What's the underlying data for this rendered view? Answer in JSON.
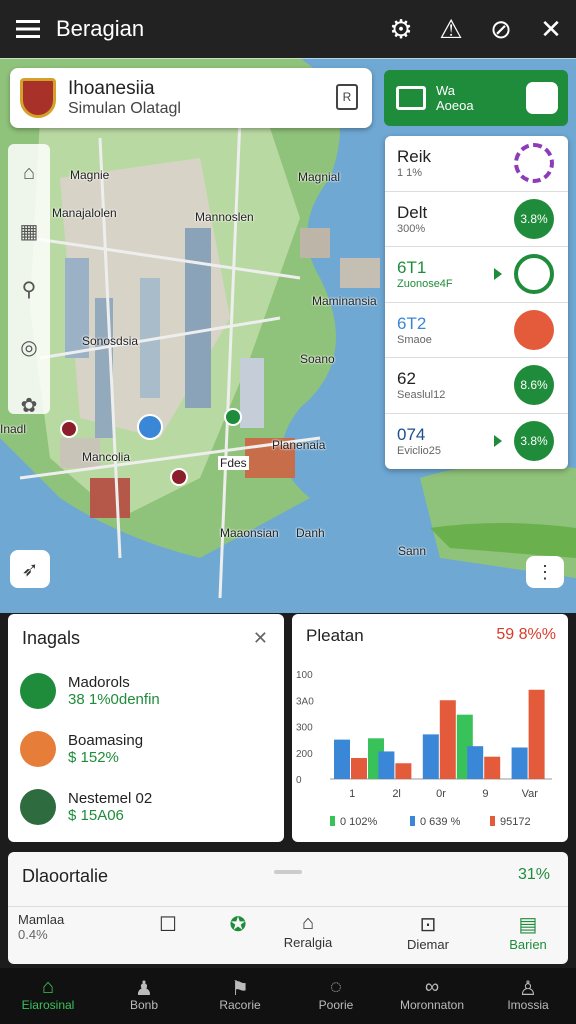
{
  "topbar": {
    "title": "Beragian"
  },
  "city_card": {
    "name": "Ihoanesiia",
    "subtitle": "Simulan Olatagl"
  },
  "action_button": {
    "line1": "Wa",
    "line2": "Aoeoa"
  },
  "right_panel": {
    "rows": [
      {
        "title": "Reik",
        "sub": "1 1%",
        "circle": ""
      },
      {
        "title": "Delt",
        "sub": "300%",
        "circle": "3.8%"
      },
      {
        "title": "6T1",
        "sub": "Zuonose4F",
        "circle": ""
      },
      {
        "title": "6T2",
        "sub": "Smaoe",
        "circle": ""
      },
      {
        "title": "62",
        "sub": "Seaslul12",
        "circle": "8.6%"
      },
      {
        "title": "074",
        "sub": "Eviclio25",
        "circle": "3.8%"
      }
    ]
  },
  "map_labels": {
    "l1": "Magnie",
    "l2": "Manajalolen",
    "l3": "Mannoslen",
    "l4": "Magnial",
    "l5": "Maminansia",
    "l6": "Sonosdsia",
    "l7": "Soano",
    "l8": "Inadl",
    "l9": "Mancolia",
    "l10": "Planenaia",
    "l11": "Maaonsian",
    "l12": "Danh",
    "l13": "Sann",
    "l14": "Fdes"
  },
  "insights": {
    "title": "Inagals",
    "items": [
      {
        "name": "Madorols",
        "value": "38 1%0denfin"
      },
      {
        "name": "Boamasing",
        "value": "$ 152%"
      },
      {
        "name": "Nestemel 02",
        "value": "$ 15A06"
      }
    ]
  },
  "chart_panel": {
    "title": "Pleatan",
    "pct": "59 8%%"
  },
  "chart_data": {
    "type": "bar",
    "categories": [
      "1",
      "2l",
      "0r",
      "9",
      "Var"
    ],
    "ylim": [
      0,
      400
    ],
    "ytick_labels": [
      "100",
      "3A0",
      "300",
      "200",
      "0"
    ],
    "legend_labels": [
      "0 102%",
      "0 639 %",
      "95172"
    ],
    "series": [
      {
        "color": "#3a87d8",
        "values": [
          150,
          105,
          170,
          125,
          120
        ]
      },
      {
        "color": "#e35b3a",
        "values": [
          80,
          60,
          300,
          85,
          340
        ]
      },
      {
        "color": "#3ac25a",
        "values": [
          155,
          0,
          245,
          0,
          0
        ]
      }
    ]
  },
  "drawer": {
    "title": "Dlaoortalie",
    "pct": "31%",
    "cells": [
      {
        "name": "Mamlaa",
        "sub": "0.4%"
      },
      {
        "name": "",
        "sub": ""
      },
      {
        "name": "Reralgia"
      },
      {
        "name": "Diemar"
      },
      {
        "name": "Barien"
      }
    ]
  },
  "bottom_nav": [
    {
      "label": "Eiarosinal"
    },
    {
      "label": "Bonb"
    },
    {
      "label": "Racorie"
    },
    {
      "label": "Poorie"
    },
    {
      "label": "Moronnaton"
    },
    {
      "label": "Imossia"
    }
  ],
  "colors": {
    "accent": "#1f8c3b",
    "red": "#e35b3a",
    "blue": "#3a87d8"
  }
}
